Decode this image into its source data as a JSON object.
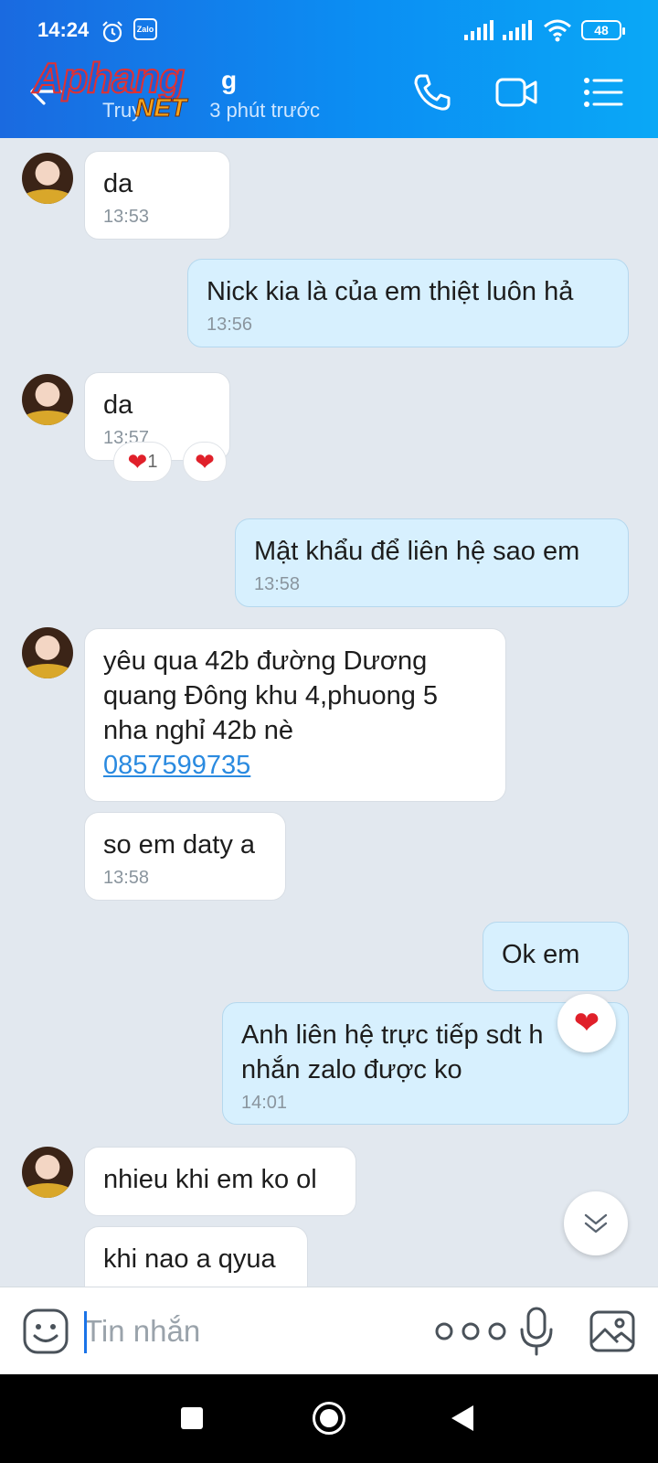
{
  "status_bar": {
    "time": "14:24",
    "zalo_label": "Zalo",
    "battery": "48"
  },
  "header": {
    "name_visible": "g",
    "status_prefix": "Truy",
    "status_suffix": "3 phút trước",
    "watermark_main": "Aphang",
    "watermark_net": "NET"
  },
  "messages": [
    {
      "dir": "in",
      "text": "da",
      "time": "13:53"
    },
    {
      "dir": "out",
      "text": "Nick kia là của em thiệt luôn hả",
      "time": "13:56"
    },
    {
      "dir": "in",
      "text": "da",
      "time": "13:57",
      "reaction_count": "1"
    },
    {
      "dir": "out",
      "text": "Mật khẩu để liên hệ sao em",
      "time": "13:58"
    },
    {
      "dir": "in",
      "lines": [
        "yêu qua   42b  đường Dương",
        "quang Đông  khu  4,phuong 5",
        "nha nghỉ 42b nè"
      ],
      "link": "0857599735"
    },
    {
      "dir": "in",
      "text": "so em daty a",
      "time": "13:58"
    },
    {
      "dir": "out",
      "text": "Ok em"
    },
    {
      "dir": "out",
      "lines": [
        "Anh liên hệ trực tiếp sdt h",
        "nhắn zalo được ko"
      ],
      "time": "14:01"
    },
    {
      "dir": "in",
      "text": "nhieu khi em ko ol"
    },
    {
      "dir": "in",
      "text": "khi nao a qyua"
    }
  ],
  "input": {
    "placeholder": "Tin nhắn"
  },
  "colors": {
    "header_start": "#1a6ae0",
    "header_end": "#0aa8f6",
    "bubble_out": "#d7f0fe",
    "bubble_in": "#ffffff",
    "link": "#2a8ae0",
    "heart": "#e0202a"
  },
  "icons": [
    "back-arrow-icon",
    "phone-icon",
    "video-call-icon",
    "menu-list-icon",
    "emoji-icon",
    "more-dots-icon",
    "microphone-icon",
    "image-icon",
    "chevron-double-down-icon",
    "heart-icon"
  ]
}
